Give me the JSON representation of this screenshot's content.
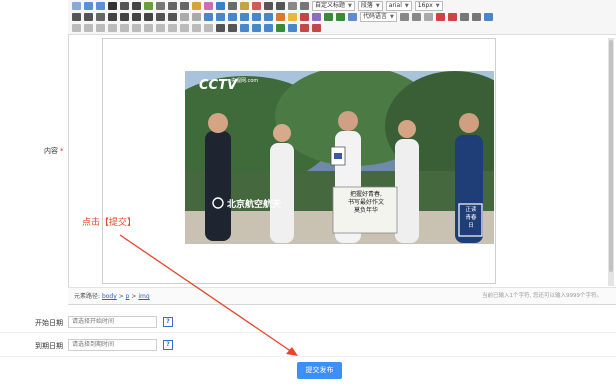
{
  "toolbar": {
    "row1": {
      "paragraph_format": "自定义标题",
      "paragraph": "段落",
      "font_family": "arial",
      "font_size": "16px"
    },
    "row2": {
      "code_language": "代码语言"
    }
  },
  "form": {
    "content_label": "内容",
    "required_mark": "*",
    "start_date_label": "开始日期",
    "start_date_placeholder": "请选择开始时间",
    "end_date_label": "到期日期",
    "end_date_placeholder": "请选择到期时间",
    "submit_label": "提交发布"
  },
  "editor": {
    "path_prefix": "元素路径:",
    "path": [
      "body",
      "p",
      "img"
    ],
    "path_sep": ">",
    "word_count": "当前已输入1个字符, 您还可以输入9999个字符。"
  },
  "image": {
    "logo": "CCTV",
    "logo_sub": "央视网.com",
    "location": "北京航空航天",
    "sign_lines": [
      "把握好青春,",
      "书写最好作文",
      "莫负年华"
    ],
    "stamp": [
      "正读",
      "青春",
      "日"
    ]
  },
  "annotation": {
    "text": "点击【提交】",
    "color": "#e8452b"
  },
  "colors": {
    "accent": "#3d8ef7",
    "required": "#e02020",
    "link": "#2a62c9"
  }
}
